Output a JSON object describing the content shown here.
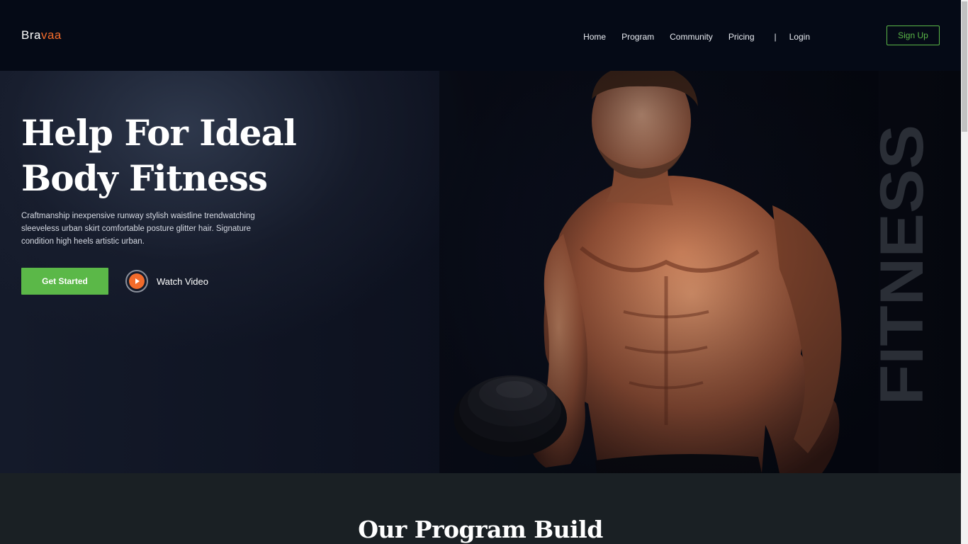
{
  "brand": {
    "logo_prefix": "Bra",
    "logo_accent": "vaa",
    "accent_color": "#f26b2b",
    "cta_color": "#5bb848"
  },
  "nav": {
    "items": [
      "Home",
      "Program",
      "Community",
      "Pricing"
    ],
    "separator": "|",
    "login": "Login",
    "signup": "Sign Up"
  },
  "hero": {
    "title": "Help For Ideal Body Fitness",
    "description": "Craftmanship inexpensive runway stylish waistline trendwatching sleeveless urban skirt comfortable posture glitter hair. Signature condition high heels artistic urban.",
    "primary_cta": "Get Started",
    "secondary_cta": "Watch Video",
    "watermark": "FITNESS",
    "image": "muscular-man-holding-dumbbell"
  },
  "program": {
    "title": "Our Program Build"
  }
}
